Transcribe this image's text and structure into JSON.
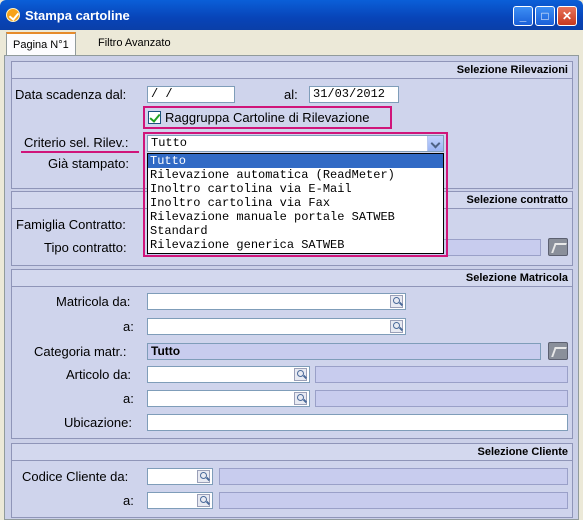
{
  "window": {
    "title": "Stampa cartoline",
    "buttons": {
      "minimize": "_",
      "maximize": "□",
      "close": "✕"
    }
  },
  "tabs": [
    {
      "label": "Pagina N°1",
      "active": true
    },
    {
      "label": "Filtro Avanzato",
      "active": false
    }
  ],
  "section_rilevazioni": {
    "title": "Selezione Rilevazioni",
    "data_scadenza_label": "Data scadenza dal:",
    "data_dal_value": "  /  /",
    "al_label": "al:",
    "data_al_value": "31/03/2012",
    "raggruppa_label": "Raggruppa Cartoline di Rilevazione",
    "raggruppa_checked": true,
    "criterio_label": "Criterio sel. Rilev.:",
    "criterio_value": "Tutto",
    "gia_stampato_label": "Già stampato:",
    "criterio_options": [
      "Tutto",
      "Rilevazione automatica (ReadMeter)",
      "Inoltro cartolina via E-Mail",
      "Inoltro cartolina via Fax",
      "Rilevazione manuale portale SATWEB",
      "Standard",
      "Rilevazione generica SATWEB"
    ]
  },
  "section_contratto": {
    "title": "Selezione contratto",
    "famiglia_label": "Famiglia Contratto:",
    "tipo_label": "Tipo contratto:"
  },
  "section_matricola": {
    "title": "Selezione Matricola",
    "matricola_da_label": "Matricola da:",
    "matricola_a_label": "a:",
    "categoria_label": "Categoria matr.:",
    "categoria_value": "Tutto",
    "articolo_da_label": "Articolo da:",
    "articolo_a_label": "a:",
    "ubicazione_label": "Ubicazione:"
  },
  "section_cliente": {
    "title": "Selezione Cliente",
    "codice_da_label": "Codice Cliente da:",
    "codice_a_label": "a:"
  },
  "colors": {
    "title_bar": "#0a5fd8",
    "highlight": "#d0157a",
    "panel": "#cfd4ec",
    "selected_item": "#316ac5"
  }
}
